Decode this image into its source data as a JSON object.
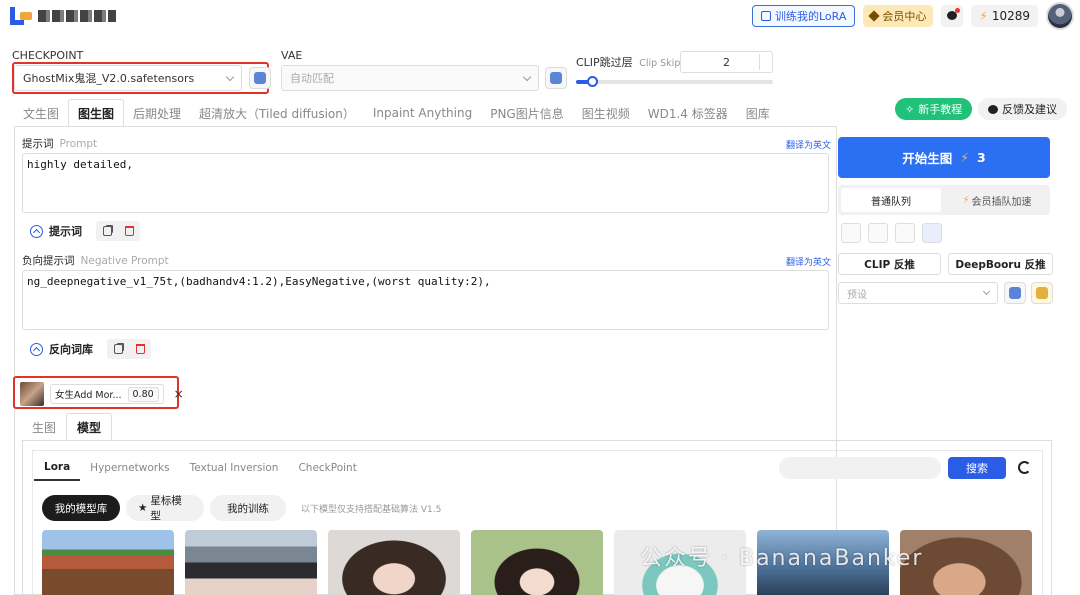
{
  "header": {
    "train_lora_label": "训练我的LoRA",
    "member_center_label": "会员中心",
    "credits": "10289"
  },
  "checkpoint": {
    "label": "CHECKPOINT",
    "value": "GhostMix鬼混_V2.0.safetensors"
  },
  "vae": {
    "label": "VAE",
    "placeholder": "自动匹配"
  },
  "clip": {
    "label": "CLIP跳过层",
    "sublabel": "Clip Skip",
    "value": "2",
    "slider_fraction": 0.08
  },
  "tabs": [
    {
      "label": "文生图"
    },
    {
      "label": "图生图"
    },
    {
      "label": "后期处理"
    },
    {
      "label": "超清放大（Tiled diffusion）"
    },
    {
      "label": "Inpaint Anything"
    },
    {
      "label": "PNG图片信息"
    },
    {
      "label": "图生视频"
    },
    {
      "label": "WD1.4 标签器"
    },
    {
      "label": "图库"
    }
  ],
  "actions": {
    "tutorial_label": "新手教程",
    "feedback_label": "反馈及建议"
  },
  "prompt": {
    "label": "提示词",
    "sublabel": "Prompt",
    "translate_label": "翻译为英文",
    "value": "highly detailed,",
    "bar_label": "提示词"
  },
  "negative": {
    "label": "负向提示词",
    "sublabel": "Negative Prompt",
    "translate_label": "翻译为英文",
    "value": "ng_deepnegative_v1_75t,(badhandv4:1.2),EasyNegative,(worst quality:2),",
    "bar_label": "反向词库"
  },
  "lora_chip": {
    "name": "女生Add Mor...",
    "weight": "0.80",
    "remove": "×"
  },
  "subtabs": [
    {
      "label": "生图"
    },
    {
      "label": "模型"
    }
  ],
  "model_tabs": [
    {
      "label": "Lora"
    },
    {
      "label": "Hypernetworks"
    },
    {
      "label": "Textual Inversion"
    },
    {
      "label": "CheckPoint"
    }
  ],
  "search_label": "搜索",
  "filters": {
    "my_library": "我的模型库",
    "starred": "星标模型",
    "my_training": "我的训练",
    "hint": "以下模型仅支持搭配基础算法 V1.5"
  },
  "right": {
    "generate_label": "开始生图",
    "generate_cost": "3",
    "queue_normal": "普通队列",
    "queue_vip": "会员插队加速",
    "clip_reverse": "CLIP 反推",
    "deepbooru_reverse": "DeepBooru 反推",
    "preset_placeholder": "预设"
  },
  "watermark": "公众号 · BananaBanker"
}
